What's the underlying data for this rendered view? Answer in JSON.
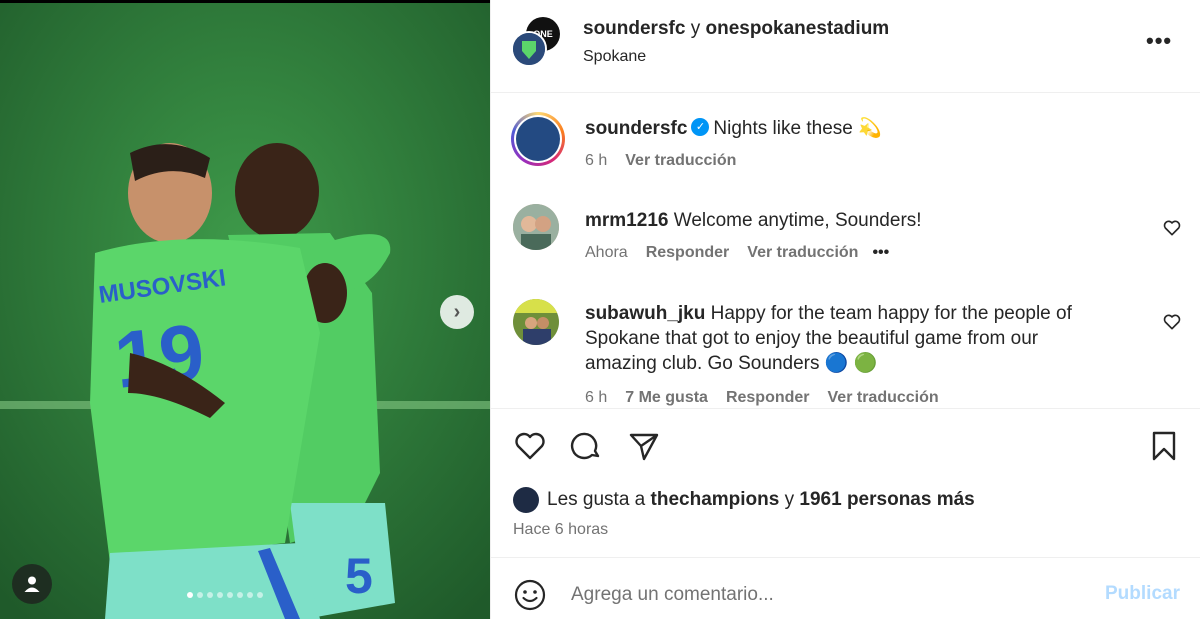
{
  "post": {
    "carousel": {
      "slide_count": 8,
      "active_slide": 1
    },
    "photo": {
      "jersey_name": "MUSOVSKI",
      "jersey_number_front": "19",
      "jersey_number_back": "5"
    }
  },
  "header": {
    "author": "soundersfc",
    "conjunction": "y",
    "collaborator": "onespokanestadium",
    "collab_avatar_text": "ONE",
    "location": "Spokane",
    "more_icon": "more-horizontal-icon"
  },
  "caption": {
    "username": "soundersfc",
    "text": "Nights like these",
    "emoji": "💫",
    "time": "6 h",
    "translate": "Ver traducción"
  },
  "comments": [
    {
      "username": "mrm1216",
      "text": "Welcome anytime, Sounders!",
      "time": "Ahora",
      "reply": "Responder",
      "translate": "Ver traducción",
      "options": "•••"
    },
    {
      "username": "subawuh_jku",
      "text_line1": "Happy for the team happy for the people of",
      "text_line2": "Spokane that got to enjoy the beautiful game from our",
      "text_line3": "amazing club. Go Sounders 🔵 🟢",
      "time": "6 h",
      "likes": "7 Me gusta",
      "reply": "Responder",
      "translate": "Ver traducción"
    }
  ],
  "likes": {
    "prefix": "Les gusta a",
    "first_user": "thechampions",
    "conjunction": "y",
    "others": "1961 personas más"
  },
  "timestamp": "Hace 6 horas",
  "composer": {
    "placeholder": "Agrega un comentario...",
    "publish": "Publicar"
  },
  "colors": {
    "link_blue": "#0095f6",
    "publish_disabled": "#b3dbff",
    "jersey_green": "#5bd66a",
    "jersey_blue": "#2a5fc9"
  }
}
